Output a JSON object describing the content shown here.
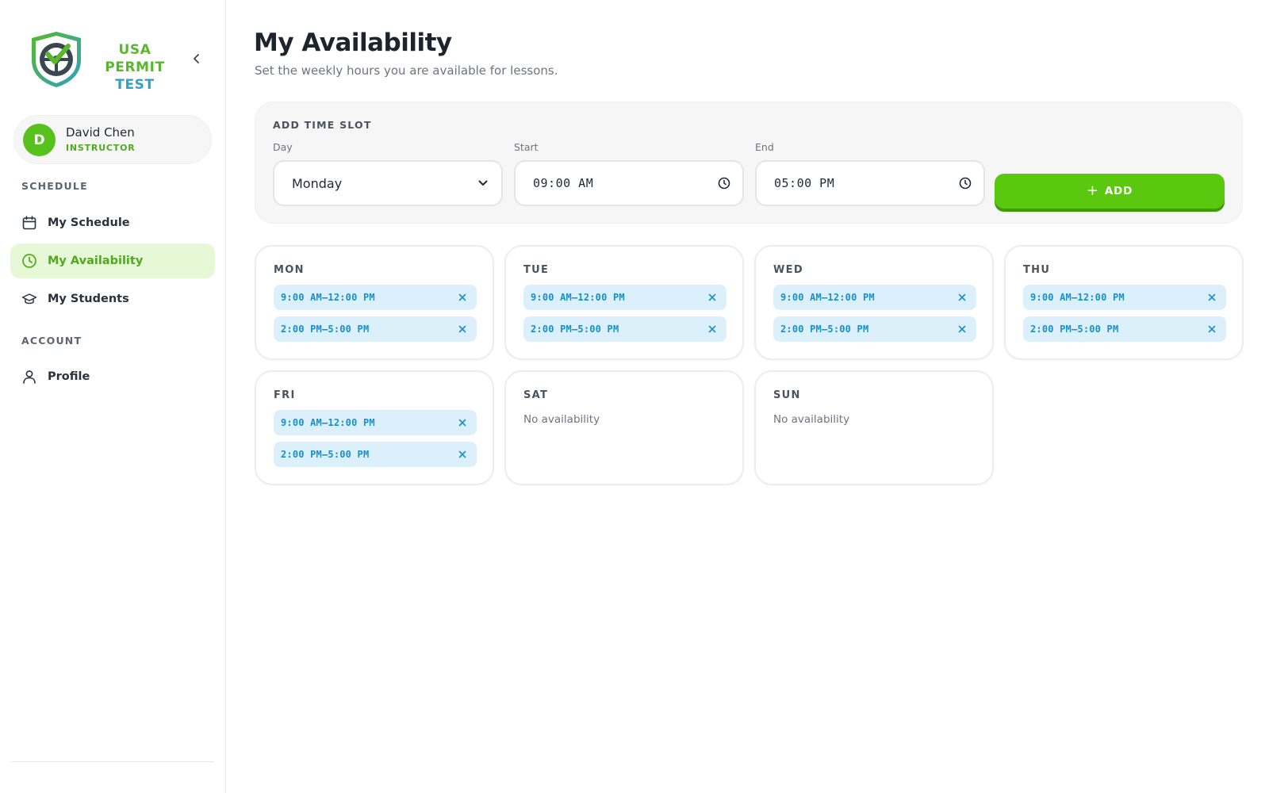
{
  "brand": {
    "line1": "USA PERMIT",
    "line2": "TEST"
  },
  "user": {
    "initial": "D",
    "name": "David Chen",
    "role": "INSTRUCTOR"
  },
  "sidebar": {
    "sections": [
      {
        "label": "SCHEDULE"
      },
      {
        "label": "ACCOUNT"
      }
    ],
    "items": [
      {
        "label": "My Schedule",
        "icon": "calendar-icon",
        "active": false
      },
      {
        "label": "My Availability",
        "icon": "clock-icon",
        "active": true
      },
      {
        "label": "My Students",
        "icon": "graduation-cap-icon",
        "active": false
      },
      {
        "label": "Profile",
        "icon": "user-icon",
        "active": false
      }
    ]
  },
  "page": {
    "title": "My Availability",
    "subtitle": "Set the weekly hours you are available for lessons."
  },
  "add_slot": {
    "title": "ADD TIME SLOT",
    "day_label": "Day",
    "day_value": "Monday",
    "start_label": "Start",
    "start_value": "09:00 AM",
    "end_label": "End",
    "end_value": "05:00 PM",
    "button_label": "ADD"
  },
  "days": [
    {
      "name": "MON",
      "slots": [
        "9:00 AM–12:00 PM",
        "2:00 PM–5:00 PM"
      ]
    },
    {
      "name": "TUE",
      "slots": [
        "9:00 AM–12:00 PM",
        "2:00 PM–5:00 PM"
      ]
    },
    {
      "name": "WED",
      "slots": [
        "9:00 AM–12:00 PM",
        "2:00 PM–5:00 PM"
      ]
    },
    {
      "name": "THU",
      "slots": [
        "9:00 AM–12:00 PM",
        "2:00 PM–5:00 PM"
      ]
    },
    {
      "name": "FRI",
      "slots": [
        "9:00 AM–12:00 PM",
        "2:00 PM–5:00 PM"
      ]
    },
    {
      "name": "SAT",
      "slots": [],
      "empty_text": "No availability"
    },
    {
      "name": "SUN",
      "slots": [],
      "empty_text": "No availability"
    }
  ],
  "colors": {
    "brand_green": "#57c21c",
    "brand_teal": "#2ea3c2",
    "active_bg": "#e7f8d6",
    "slot_bg": "#dcf0fb",
    "slot_text": "#1a8fc7"
  }
}
